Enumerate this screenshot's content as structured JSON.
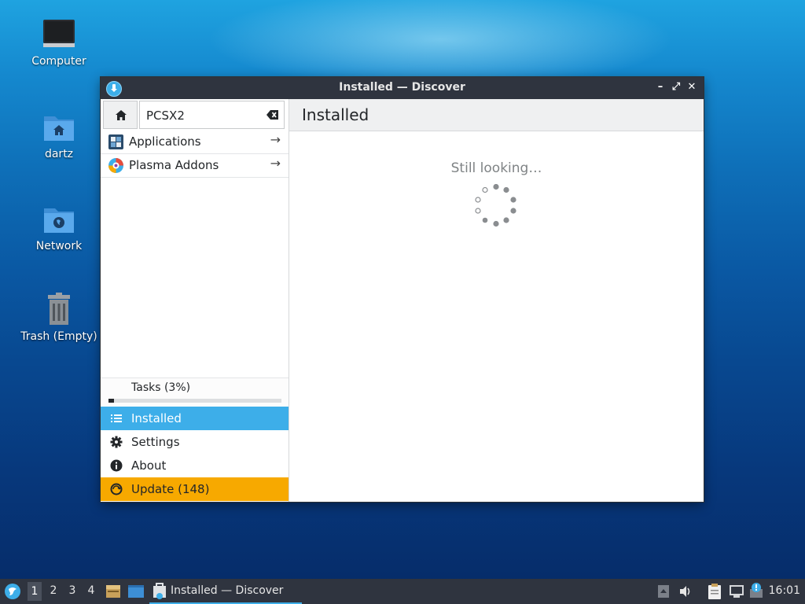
{
  "desktop": {
    "icons": [
      {
        "label": "Computer"
      },
      {
        "label": "dartz"
      },
      {
        "label": "Network"
      },
      {
        "label": "Trash (Empty)"
      }
    ]
  },
  "window": {
    "title": "Installed — Discover",
    "controls": {
      "minimize": "–",
      "maximize": "⤢",
      "close": "✕"
    }
  },
  "search": {
    "value": "PCSX2"
  },
  "categories": [
    {
      "label": "Applications",
      "icon": "applications-icon"
    },
    {
      "label": "Plasma Addons",
      "icon": "plasma-addons-icon"
    }
  ],
  "tasks": {
    "label": "Tasks (3%)",
    "progress": 0.03
  },
  "nav": {
    "installed": "Installed",
    "settings": "Settings",
    "about": "About",
    "update": "Update (148)"
  },
  "content": {
    "title": "Installed",
    "status": "Still looking…"
  },
  "taskbar": {
    "desktops": [
      "1",
      "2",
      "3",
      "4"
    ],
    "active_desktop": "1",
    "task_label": "Installed — Discover",
    "clock": "16:01"
  },
  "colors": {
    "accent": "#3daee9",
    "update": "#f7a900",
    "titlebar": "#2f343f"
  }
}
